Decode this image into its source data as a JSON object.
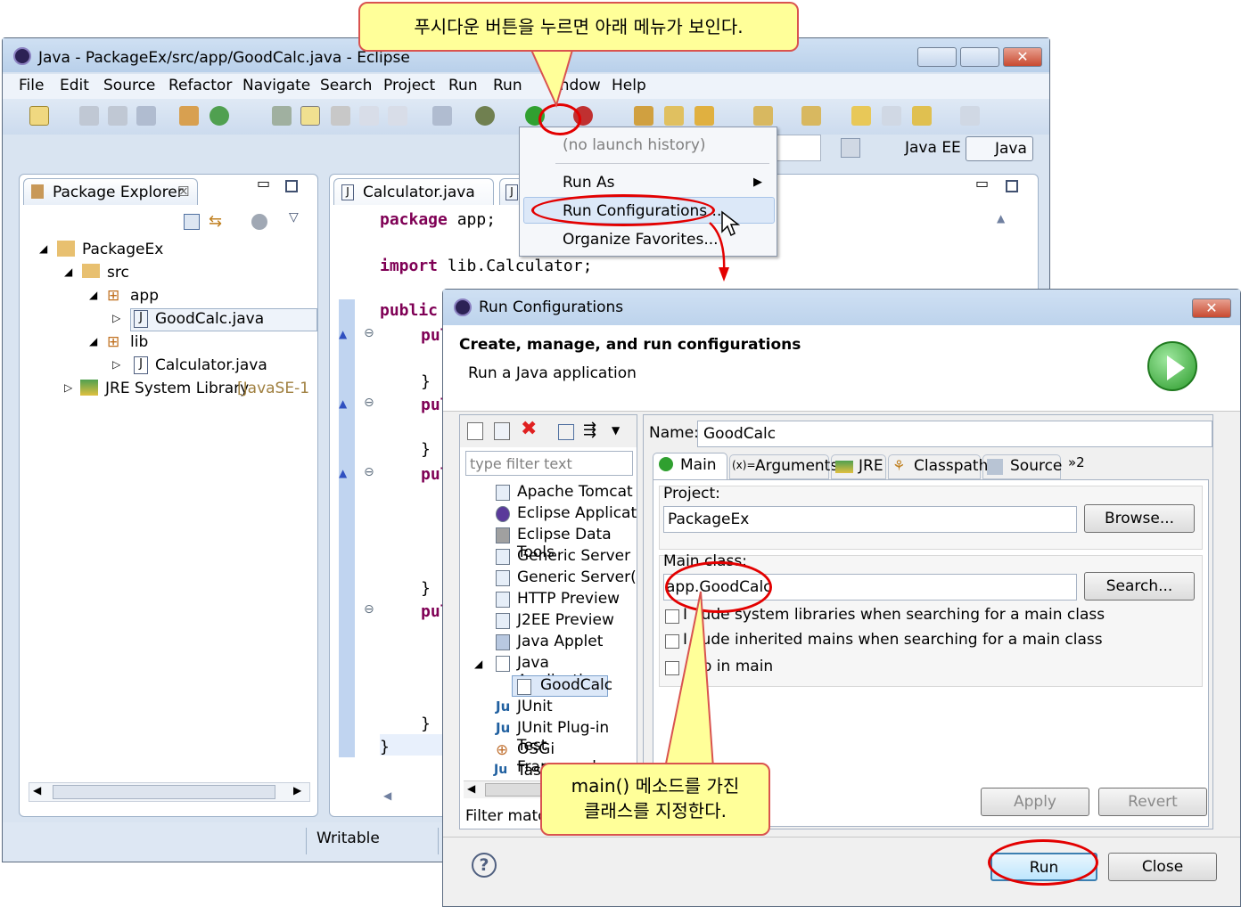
{
  "eclipse": {
    "title": "Java - PackageEx/src/app/GoodCalc.java - Eclipse",
    "menu": [
      "File",
      "Edit",
      "Source",
      "Refactor",
      "Navigate",
      "Search",
      "Project",
      "Run",
      "Run",
      "indow",
      "Help"
    ],
    "perspectives": [
      "Java EE",
      "Java"
    ],
    "package_explorer": {
      "title": "Package Explorer",
      "items": [
        "PackageEx",
        "src",
        "app",
        "GoodCalc.java",
        "lib",
        "Calculator.java",
        "JRE System Library",
        "[JavaSE-1."
      ]
    },
    "editor": {
      "tab": "Calculator.java",
      "lines": [
        "package app;",
        "import lib.Calculator;",
        "public",
        "pul",
        "}",
        "pul",
        "}",
        "pul",
        "}",
        "pul",
        "}",
        "}"
      ]
    },
    "status": "Writable"
  },
  "dropdown": {
    "items": [
      "(no launch history)",
      "Run As",
      "Run Configurations...",
      "Organize Favorites..."
    ]
  },
  "callouts": {
    "top": "푸시다운 버튼을 누르면 아래 메뉴가 보인다.",
    "bottom_1": "main() 메소드를 가진",
    "bottom_2": "클래스를 지정한다."
  },
  "dialog": {
    "title": "Run Configurations",
    "heading": "Create, manage, and run configurations",
    "subheading": "Run a Java application",
    "filter_placeholder": "type filter text",
    "tree": [
      "Apache Tomcat",
      "Eclipse Application",
      "Eclipse Data Tools",
      "Generic Server",
      "Generic Server(Ext",
      "HTTP Preview",
      "J2EE Preview",
      "Java Applet",
      "Java Application",
      "GoodCalc",
      "JUnit",
      "JUnit Plug-in Test",
      "OSGi Framework",
      "Task"
    ],
    "filter_status": "Filter match",
    "name_label": "Name:",
    "name_value": "GoodCalc",
    "tabs": [
      "Main",
      "Arguments",
      "JRE",
      "Classpath",
      "Source",
      "»2"
    ],
    "project_label": "Project:",
    "project_value": "PackageEx",
    "browse": "Browse...",
    "main_class_label": "Main class:",
    "main_class_value": "app.GoodCalc",
    "search": "Search...",
    "checks": [
      "Include system libraries when searching for a main class",
      "Include inherited mains when searching for a main class",
      "Stop in main"
    ],
    "check_display": [
      "I  lude system libraries when searching for a main class",
      "I  lude inherited mains when searching for a main class",
      "    p in main"
    ],
    "apply": "Apply",
    "revert": "Revert",
    "run": "Run",
    "close": "Close",
    "help": "?"
  },
  "colors": {
    "accent_red": "#e30000",
    "callout_bg": "#ffff99",
    "keyword": "#7f0055"
  }
}
